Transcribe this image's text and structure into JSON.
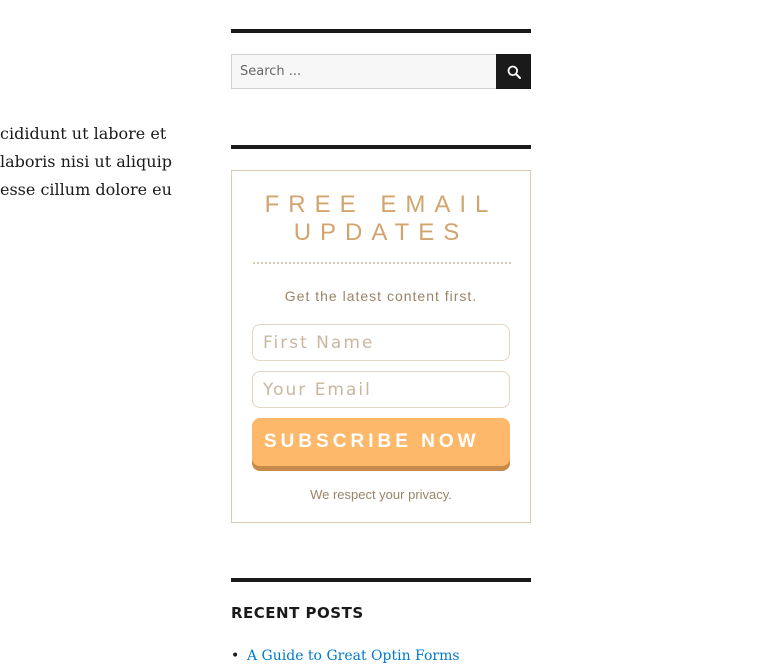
{
  "body_text": {
    "lines": [
      "cididunt ut labore et",
      "laboris nisi ut aliquip",
      "esse cillum dolore eu"
    ]
  },
  "search": {
    "placeholder": "Search ...",
    "button_icon": "search-icon"
  },
  "optin": {
    "title_line1": "FREE EMAIL",
    "title_line2": "UPDATES",
    "subtitle": "Get the latest content first.",
    "first_name_placeholder": "First Name",
    "email_placeholder": "Your Email",
    "button_label": "SUBSCRIBE NOW",
    "privacy_text": "We respect your privacy.",
    "colors": {
      "title": "#d2a46e",
      "button": "#fdb86a",
      "button_shadow": "#c88a4b",
      "border": "#d9cbb6"
    }
  },
  "recent_posts": {
    "title": "RECENT POSTS",
    "items": [
      {
        "label": "A Guide to Great Optin Forms",
        "link_color": "#007acc"
      }
    ]
  }
}
